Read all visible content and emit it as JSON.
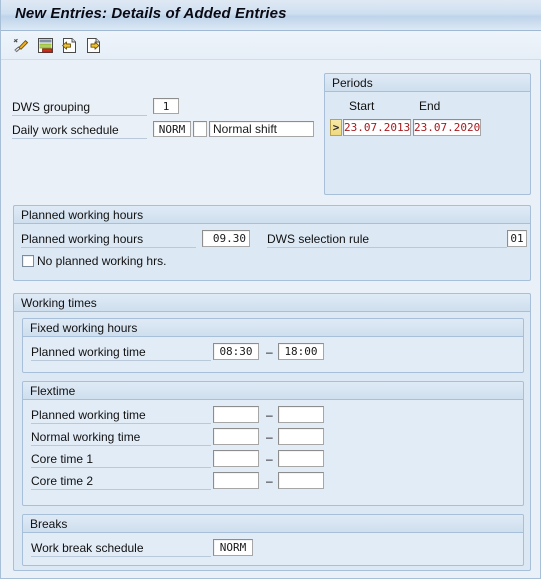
{
  "window": {
    "title": "New Entries: Details of Added Entries"
  },
  "toolbar": {
    "buttons": [
      {
        "name": "check-entries-icon",
        "label": "Check entries"
      },
      {
        "name": "copy-as-icon",
        "label": "Copy as"
      },
      {
        "name": "previous-entry-icon",
        "label": "Previous entry"
      },
      {
        "name": "next-entry-icon",
        "label": "Next entry"
      }
    ]
  },
  "header_form": {
    "dws_grouping_label": "DWS grouping",
    "dws_grouping_value": "1",
    "daily_work_schedule_label": "Daily work schedule",
    "daily_work_schedule_key": "NORM",
    "daily_work_schedule_variant": "",
    "daily_work_schedule_text": "Normal shift"
  },
  "periods": {
    "title": "Periods",
    "col_start": "Start",
    "col_end": "End",
    "row_selector": ">",
    "start_value": "23.07.2013",
    "end_value": "23.07.2020",
    "date_color": "#a61b20"
  },
  "planned_working_hours": {
    "title": "Planned working hours",
    "hours_label": "Planned working hours",
    "hours_value": "09.30",
    "dws_selection_rule_label": "DWS selection rule",
    "dws_selection_rule_value": "01",
    "no_planned_label": "No planned working hrs.",
    "no_planned_checked": false
  },
  "working_times": {
    "title": "Working times",
    "fixed": {
      "title": "Fixed working hours",
      "rows": [
        {
          "label": "Planned working time",
          "from": "08:30",
          "sep": "–",
          "to": "18:00"
        }
      ]
    },
    "flextime": {
      "title": "Flextime",
      "rows": [
        {
          "label": "Planned working time",
          "from": "",
          "sep": "–",
          "to": ""
        },
        {
          "label": "Normal working time",
          "from": "",
          "sep": "–",
          "to": ""
        },
        {
          "label": "Core time 1",
          "from": "",
          "sep": "–",
          "to": ""
        },
        {
          "label": "Core time 2",
          "from": "",
          "sep": "–",
          "to": ""
        }
      ]
    },
    "breaks": {
      "title": "Breaks",
      "work_break_schedule_label": "Work break schedule",
      "work_break_schedule_value": "NORM"
    }
  }
}
